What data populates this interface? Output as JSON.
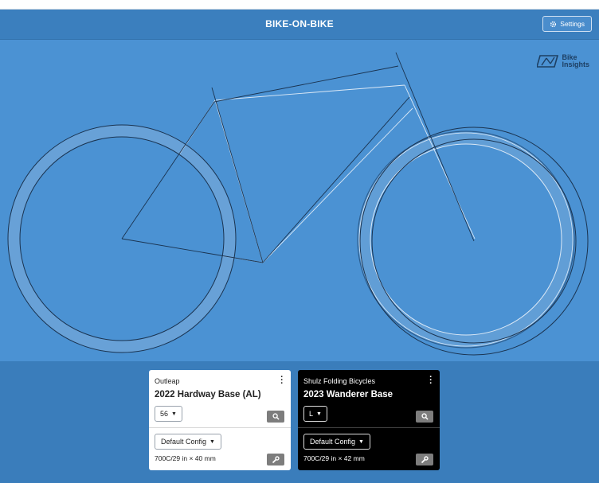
{
  "app": {
    "title": "BIKE-ON-BIKE"
  },
  "header": {
    "settings_label": "Settings",
    "settings_icon": "gear-icon"
  },
  "logo": {
    "line1": "Bike",
    "line2": "Insights"
  },
  "colors": {
    "header_bg": "#3b7fbe",
    "canvas_bg": "#4b92d3",
    "bike1_stroke": "#1a3350",
    "bike2_stroke": "#dce9f6"
  },
  "cards": [
    {
      "theme": "light",
      "brand": "Outleap",
      "model": "2022 Hardway Base (AL)",
      "size": "56",
      "config": "Default Config",
      "tire": "700C/29 in × 40 mm"
    },
    {
      "theme": "dark",
      "brand": "Shulz Folding Bicycles",
      "model": "2023 Wanderer Base",
      "size": "L",
      "config": "Default Config",
      "tire": "700C/29 in × 42 mm"
    }
  ]
}
